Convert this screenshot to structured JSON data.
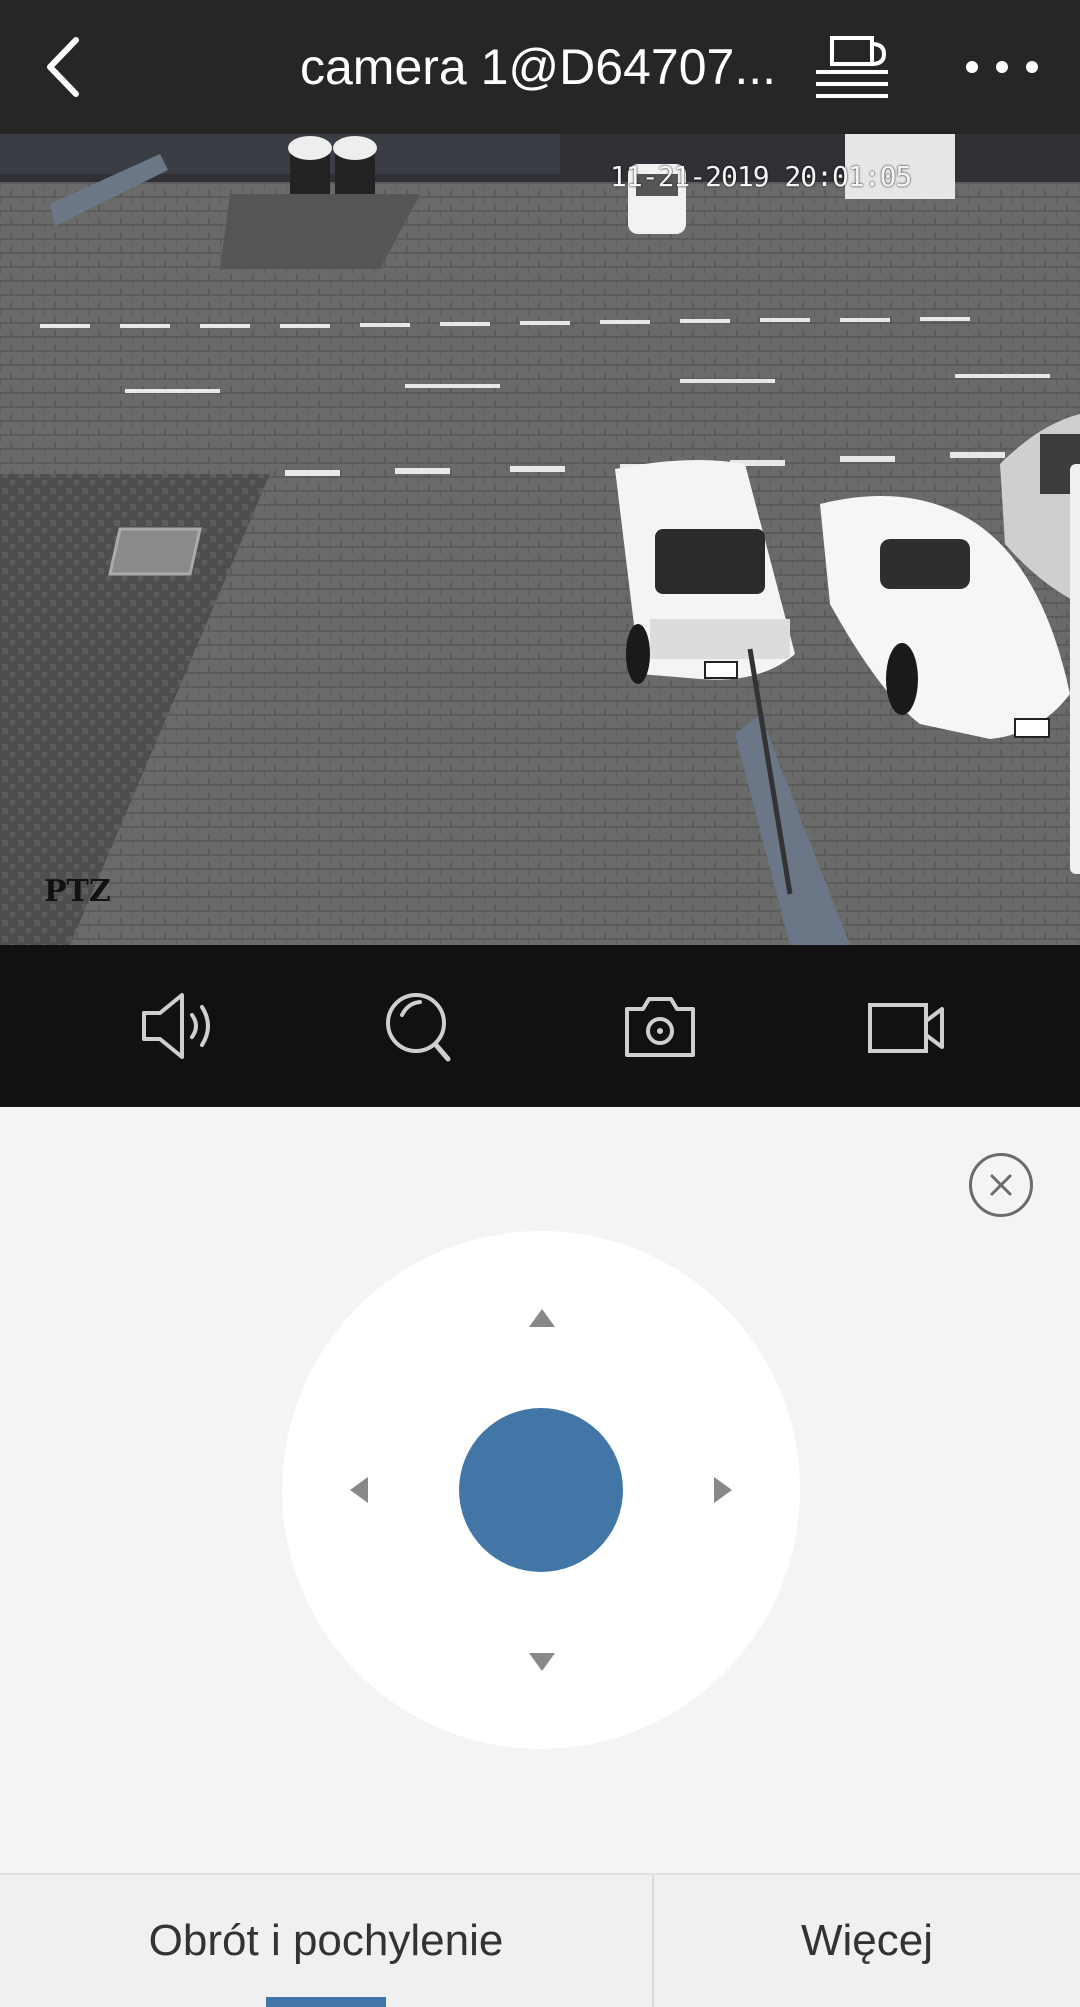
{
  "header": {
    "title": "camera 1@D64707...",
    "back_icon": "chevron-left-icon",
    "cast_icon": "device-cast-icon",
    "more_icon": "more-dots-icon"
  },
  "video": {
    "timestamp": "11-21-2019 20:01:05",
    "overlay_label": "PTZ"
  },
  "toolbar": {
    "items": [
      {
        "name": "audio",
        "icon": "speaker-icon"
      },
      {
        "name": "zoom",
        "icon": "magnifier-icon"
      },
      {
        "name": "snapshot",
        "icon": "camera-icon"
      },
      {
        "name": "record",
        "icon": "video-record-icon"
      }
    ]
  },
  "ptz": {
    "close_icon": "close-icon",
    "knob_color": "#4276a6"
  },
  "tabs": [
    {
      "label": "Obrót i pochylenie",
      "active": true
    },
    {
      "label": "Więcej",
      "active": false
    }
  ],
  "colors": {
    "header_bg": "#262626",
    "toolbar_bg": "#111111",
    "panel_bg": "#f4f4f4",
    "accent": "#4276a6"
  }
}
